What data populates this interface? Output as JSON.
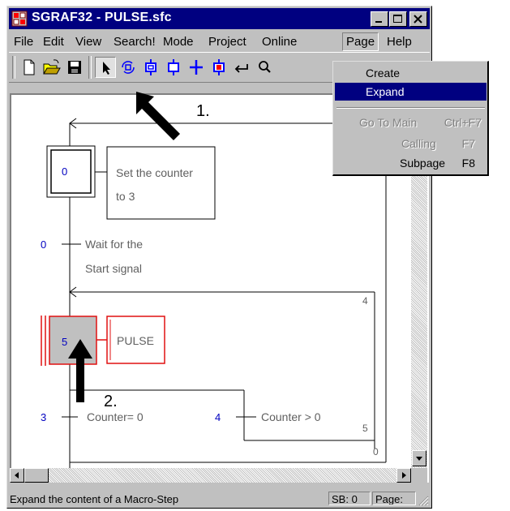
{
  "window": {
    "title": "SGRAF32 - PULSE.sfc"
  },
  "menu": {
    "items": [
      "File",
      "Edit",
      "View",
      "Search!",
      "Mode",
      "Project",
      "Online",
      "Page",
      "Help"
    ],
    "active": "Page"
  },
  "page_menu": {
    "create": "Create",
    "expand": "Expand",
    "go_to_main": "Go To Main",
    "go_to_main_shortcut": "Ctrl+F7",
    "calling": "Calling",
    "calling_shortcut": "F7",
    "subpage": "Subpage",
    "subpage_shortcut": "F8"
  },
  "toolbar": {
    "icons": [
      "new-file-icon",
      "open-folder-icon",
      "save-disk-icon",
      "select-arrow-icon",
      "macro-step-icon",
      "step-icon",
      "initial-step-icon",
      "transition-icon",
      "jump-icon",
      "link-icon",
      "zoom-icon"
    ]
  },
  "diagram": {
    "initial_step_number": "0",
    "initial_action_line1": "Set the counter",
    "initial_action_line2": "to 3",
    "transition0_number": "0",
    "transition0_line1": "Wait for the",
    "transition0_line2": "Start signal",
    "macro_step_number": "5",
    "macro_action": "PULSE",
    "transition3_number": "3",
    "transition3_condition": "Counter= 0",
    "transition4_number": "4",
    "transition4_condition": "Counter > 0",
    "jump_label_4": "4",
    "jump_label_5": "5",
    "jump_label_0": "0"
  },
  "annotations": {
    "arrow1_label": "1.",
    "arrow2_label": "2."
  },
  "statusbar": {
    "message": "Expand the content of a Macro-Step",
    "sb": "SB: 0",
    "page": "Page:"
  },
  "colors": {
    "title_bar": "#000080",
    "step_number": "#0000c0",
    "selected_step": "#e01010",
    "highlight": "#000080"
  }
}
